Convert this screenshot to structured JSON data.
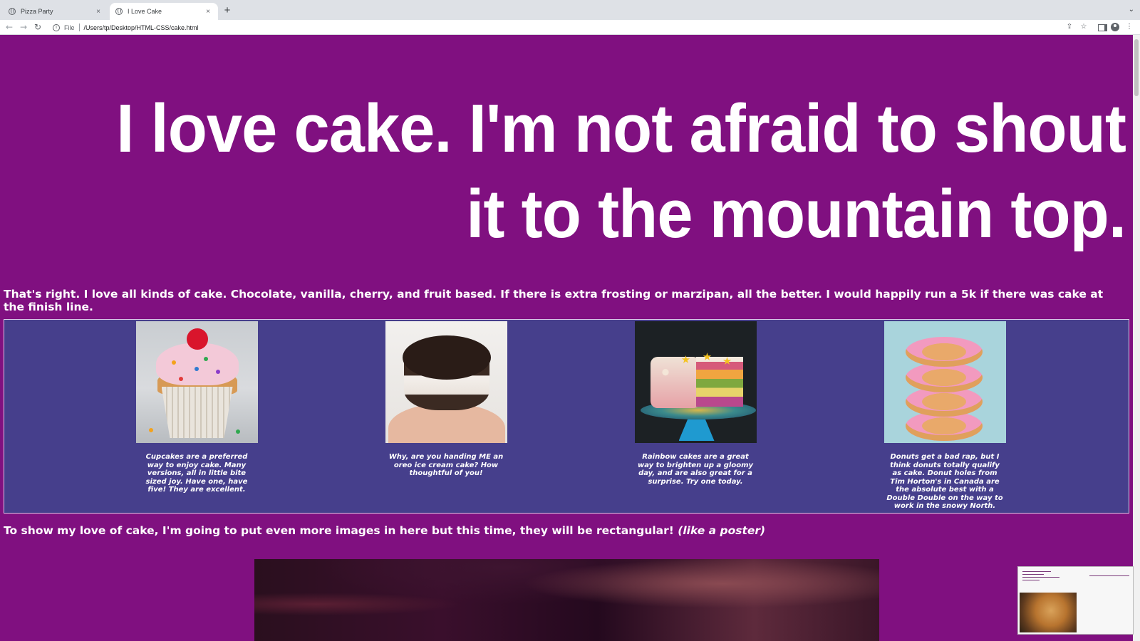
{
  "browser": {
    "tabs": [
      {
        "title": "Pizza Party",
        "close": "×"
      },
      {
        "title": "I Love Cake",
        "close": "×"
      }
    ],
    "new_tab": "+",
    "collapse": "⌄",
    "address": {
      "info": "i",
      "scheme": "File",
      "url": "/Users/tp/Desktop/HTML-CSS/cake.html"
    },
    "nav": {
      "back": "←",
      "forward": "→",
      "reload": "↻"
    },
    "toolbar_icons": {
      "share": "⇪",
      "star": "☆",
      "menu": "⋮"
    }
  },
  "page": {
    "background": "#801080",
    "hero": "I love cake. I'm not afraid to shout it to the mountain top.",
    "intro": "That's right. I love all kinds of cake. Chocolate, vanilla, cherry, and fruit based. If there is extra frosting or marzipan, all the better. I would happily run a 5k if there was cake at the finish line.",
    "gallery": {
      "background": "#463f8c",
      "items": [
        {
          "photo": "cupcake-photo",
          "caption": "Cupcakes are a preferred way to enjoy cake. Many versions, all in little bite sized joy. Have one, have five! They are excellent."
        },
        {
          "photo": "oreo-cake-photo",
          "caption": "Why, are you handing ME an oreo ice cream cake? How thoughtful of you!"
        },
        {
          "photo": "rainbow-cake-photo",
          "caption": "Rainbow cakes are a great way to brighten up a gloomy day, and are also great for a surprise. Try one today."
        },
        {
          "photo": "donut-stack-photo",
          "caption": "Donuts get a bad rap, but I think donuts totally qualify as cake. Donut holes from Tim Horton's in Canada are the absolute best with a Double Double on the way to work in the snowy North."
        }
      ]
    },
    "poster_text": "To show my love of cake, I'm going to put even more images in here but this time, they will be rectangular!",
    "poster_text_em": "(like a poster)"
  }
}
